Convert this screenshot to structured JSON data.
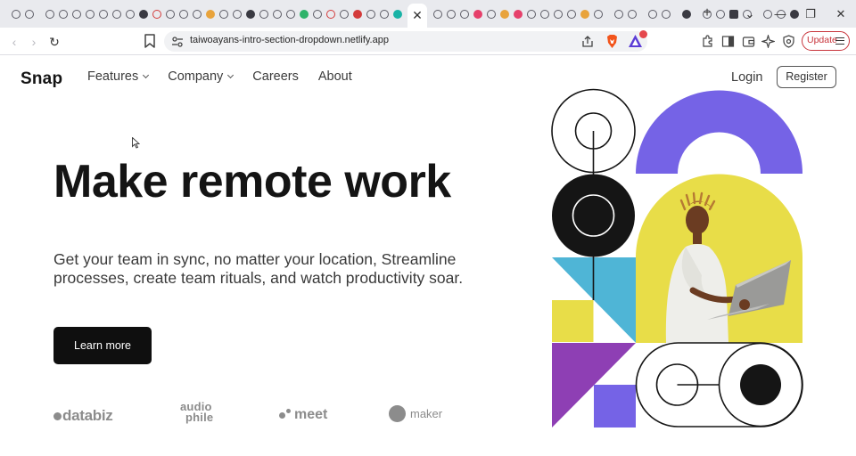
{
  "browser": {
    "url": "taiwoayans-intro-section-dropdown.netlify.app",
    "update_label": "Update",
    "active_tab_close": "✕",
    "new_tab": "+",
    "window_controls": {
      "dropdown": "⌄",
      "minimize": "—",
      "restore": "❐",
      "close": "✕"
    },
    "nav": {
      "back": "‹",
      "forward": "›",
      "reload": "↻"
    }
  },
  "header": {
    "logo": "Snap",
    "nav_items": [
      {
        "label": "Features",
        "has_dropdown": true
      },
      {
        "label": "Company",
        "has_dropdown": true
      },
      {
        "label": "Careers",
        "has_dropdown": false
      },
      {
        "label": "About",
        "has_dropdown": false
      }
    ],
    "login": "Login",
    "register": "Register"
  },
  "hero": {
    "title": "Make remote work",
    "description": "Get your team in sync, no matter your location, Streamline processes, create team rituals, and watch productivity soar.",
    "cta": "Learn more"
  },
  "clients": [
    {
      "name": "databiz"
    },
    {
      "name": "audiophile",
      "line1": "audio",
      "line2": "phile"
    },
    {
      "name": "meet"
    },
    {
      "name": "maker"
    }
  ],
  "colors": {
    "accent_purple": "#7563e6",
    "yellow": "#e8dd48",
    "blue": "#4fb5d6",
    "magenta": "#8e3fb4",
    "dark": "#151515",
    "brand_red": "#c8343b"
  }
}
